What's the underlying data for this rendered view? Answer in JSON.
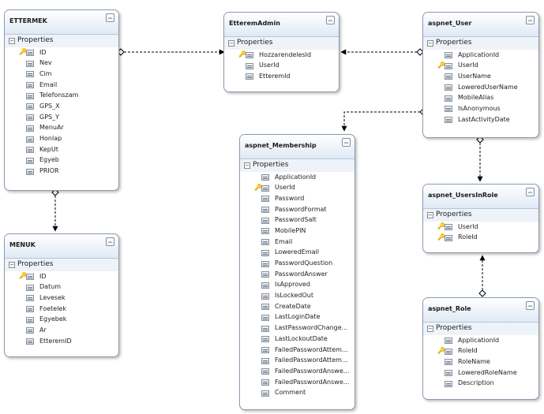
{
  "section_label": "Properties",
  "entities": [
    {
      "name": "ETTERMEK",
      "properties": [
        {
          "name": "ID",
          "key": true
        },
        {
          "name": "Nev"
        },
        {
          "name": "Cim"
        },
        {
          "name": "Email"
        },
        {
          "name": "Telefonszam"
        },
        {
          "name": "GPS_X"
        },
        {
          "name": "GPS_Y"
        },
        {
          "name": "MenuAr"
        },
        {
          "name": "Honlap"
        },
        {
          "name": "KepUt"
        },
        {
          "name": "Egyeb"
        },
        {
          "name": "PRIOR"
        }
      ]
    },
    {
      "name": "MENUK",
      "properties": [
        {
          "name": "ID",
          "key": true
        },
        {
          "name": "Datum"
        },
        {
          "name": "Levesek"
        },
        {
          "name": "Foetelek"
        },
        {
          "name": "Egyebek"
        },
        {
          "name": "Ar"
        },
        {
          "name": "EtteremID"
        }
      ]
    },
    {
      "name": "EtteremAdmin",
      "properties": [
        {
          "name": "HozzarendelesId",
          "key": true
        },
        {
          "name": "UserId"
        },
        {
          "name": "EtteremId"
        }
      ]
    },
    {
      "name": "aspnet_Membership",
      "properties": [
        {
          "name": "ApplicationId"
        },
        {
          "name": "UserId",
          "key": true
        },
        {
          "name": "Password"
        },
        {
          "name": "PasswordFormat"
        },
        {
          "name": "PasswordSalt"
        },
        {
          "name": "MobilePIN"
        },
        {
          "name": "Email"
        },
        {
          "name": "LoweredEmail"
        },
        {
          "name": "PasswordQuestion"
        },
        {
          "name": "PasswordAnswer"
        },
        {
          "name": "IsApproved"
        },
        {
          "name": "IsLockedOut"
        },
        {
          "name": "CreateDate"
        },
        {
          "name": "LastLoginDate"
        },
        {
          "name": "LastPasswordChange..."
        },
        {
          "name": "LastLockoutDate"
        },
        {
          "name": "FailedPasswordAttem..."
        },
        {
          "name": "FailedPasswordAttem..."
        },
        {
          "name": "FailedPasswordAnswe..."
        },
        {
          "name": "FailedPasswordAnswe..."
        },
        {
          "name": "Comment"
        }
      ]
    },
    {
      "name": "aspnet_User",
      "properties": [
        {
          "name": "ApplicationId"
        },
        {
          "name": "UserId",
          "key": true
        },
        {
          "name": "UserName"
        },
        {
          "name": "LoweredUserName"
        },
        {
          "name": "MobileAlias"
        },
        {
          "name": "IsAnonymous"
        },
        {
          "name": "LastActivityDate"
        }
      ]
    },
    {
      "name": "aspnet_UsersInRole",
      "properties": [
        {
          "name": "UserId",
          "key": true
        },
        {
          "name": "RoleId",
          "key": true
        }
      ]
    },
    {
      "name": "aspnet_Role",
      "properties": [
        {
          "name": "ApplicationId"
        },
        {
          "name": "RoleId",
          "key": true
        },
        {
          "name": "RoleName"
        },
        {
          "name": "LoweredRoleName"
        },
        {
          "name": "Description"
        }
      ]
    }
  ],
  "associations": [
    {
      "from": "ETTERMEK",
      "to": "EtteremAdmin"
    },
    {
      "from": "ETTERMEK",
      "to": "MENUK"
    },
    {
      "from": "aspnet_User",
      "to": "EtteremAdmin"
    },
    {
      "from": "aspnet_User",
      "to": "aspnet_Membership"
    },
    {
      "from": "aspnet_User",
      "to": "aspnet_UsersInRole"
    },
    {
      "from": "aspnet_Role",
      "to": "aspnet_UsersInRole"
    }
  ]
}
